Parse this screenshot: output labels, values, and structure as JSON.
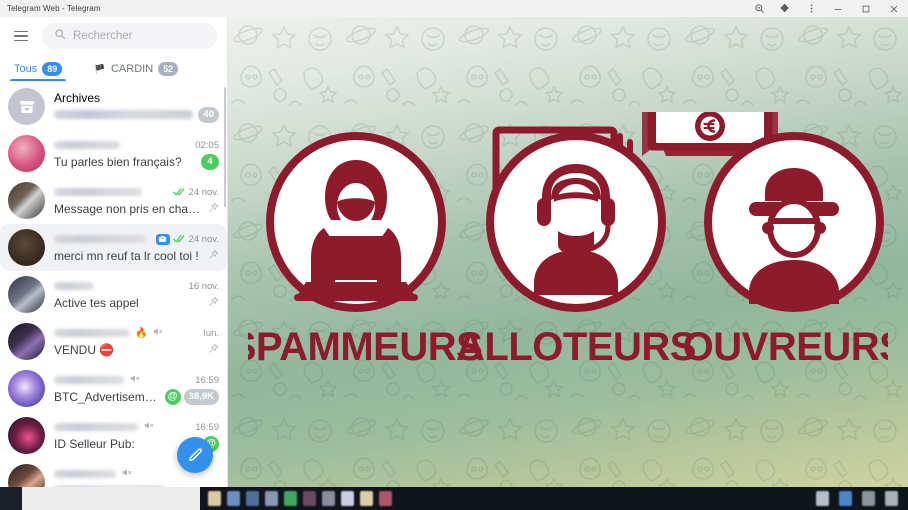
{
  "browser": {
    "tab_title": "Telegram Web - Telegram",
    "controls": [
      {
        "name": "zoom-icon",
        "label": "zoom"
      },
      {
        "name": "extensions-puzzle-icon",
        "label": "extensions"
      },
      {
        "name": "more-menu-icon",
        "label": "menu"
      },
      {
        "name": "minimize-icon",
        "label": "minimize"
      },
      {
        "name": "maximize-icon",
        "label": "maximize"
      },
      {
        "name": "close-icon",
        "label": "close"
      }
    ]
  },
  "sidebar": {
    "menu_icon": "hamburger-menu-icon",
    "search": {
      "placeholder": "Rechercher",
      "value": "",
      "icon": "search-icon"
    },
    "tabs": [
      {
        "label": "Tous",
        "count": "89",
        "active": true,
        "flag": ""
      },
      {
        "label": "CARDIN",
        "count": "52",
        "active": false,
        "flag": "🏴"
      }
    ],
    "compose_button": "pencil-compose-icon",
    "chats": [
      {
        "title": "Archives",
        "title_blurred": false,
        "preview": "",
        "preview_blurred": true,
        "time": "",
        "badge": "40",
        "badge_kind": "gray",
        "avatar_kind": "archive",
        "selected": false,
        "pinned": false,
        "read_receipt": false,
        "muted": false
      },
      {
        "title": "",
        "title_blurred": true,
        "preview": "Tu parles bien français?",
        "preview_blurred": false,
        "time": "02:05",
        "badge": "4",
        "badge_kind": "green",
        "avatar_kind": "panda",
        "selected": false,
        "pinned": false,
        "read_receipt": false,
        "muted": false
      },
      {
        "title": "",
        "title_blurred": true,
        "preview": "Message non pris en charge",
        "preview_blurred": false,
        "time": "24 nov.",
        "badge": "",
        "badge_kind": "",
        "avatar_kind": "photo-brown",
        "selected": false,
        "pinned": true,
        "read_receipt": true,
        "muted": false
      },
      {
        "title": "",
        "title_blurred": true,
        "preview": "merci mn reuf ta lr cool toi !",
        "preview_blurred": false,
        "time": "24 nov.",
        "badge": "",
        "badge_kind": "",
        "avatar_kind": "photo-dark",
        "selected": true,
        "pinned": true,
        "read_receipt": true,
        "muted": false,
        "bot_badge": true
      },
      {
        "title": "",
        "title_blurred": true,
        "preview": "Active tes appel",
        "preview_blurred": false,
        "time": "16 nov.",
        "badge": "",
        "badge_kind": "",
        "avatar_kind": "photo-statue",
        "selected": false,
        "pinned": true,
        "read_receipt": false,
        "muted": false
      },
      {
        "title": "",
        "title_blurred": true,
        "preview": "VENDU ⛔",
        "preview_blurred": false,
        "time": "lun.",
        "badge": "",
        "badge_kind": "",
        "avatar_kind": "photo-purple",
        "selected": false,
        "pinned": true,
        "read_receipt": false,
        "muted": true,
        "fire": "🔥"
      },
      {
        "title": "",
        "title_blurred": true,
        "preview": "BTC_Advertisement …",
        "preview_blurred": false,
        "time": "16:59",
        "badge": "38,9K",
        "badge_kind": "gray",
        "avatar_kind": "photo-galaxy",
        "selected": false,
        "pinned": false,
        "read_receipt": false,
        "muted": true,
        "mention": "@"
      },
      {
        "title": "",
        "title_blurred": true,
        "preview": "ID Selleur Pub:",
        "preview_blurred": false,
        "time": "16:59",
        "badge": "",
        "badge_kind": "",
        "avatar_kind": "photo-pink",
        "selected": false,
        "pinned": false,
        "read_receipt": false,
        "muted": true,
        "mention": "@"
      },
      {
        "title": "",
        "title_blurred": true,
        "preview": "",
        "preview_blurred": true,
        "time": "",
        "badge": "",
        "badge_kind": "",
        "avatar_kind": "photo-person",
        "selected": false,
        "pinned": false,
        "read_receipt": false,
        "muted": true
      }
    ]
  },
  "chat_pane": {
    "wallpaper": "space-doodle-pattern",
    "poster": {
      "accent_color": "#8e1b2c",
      "items": [
        {
          "label": "SPAMMEURS",
          "icon": "hooded-hacker-laptop-icon"
        },
        {
          "label": "ALLOTEURS",
          "icon": "headset-operator-icon"
        },
        {
          "label": "OUVREURS",
          "icon": "capped-person-icon"
        }
      ],
      "decoration": "euro-banknotes-icon"
    }
  },
  "taskbar": {
    "items": [
      {
        "name": "taskbar-icon-1",
        "color": "#d9c9a2"
      },
      {
        "name": "taskbar-icon-2",
        "color": "#6a8fc0"
      },
      {
        "name": "taskbar-icon-3",
        "color": "#4f6f9a"
      },
      {
        "name": "taskbar-icon-4",
        "color": "#8a97b5"
      },
      {
        "name": "taskbar-icon-5",
        "color": "#3fa85e"
      },
      {
        "name": "taskbar-icon-6",
        "color": "#6a4a63"
      },
      {
        "name": "taskbar-icon-7",
        "color": "#8d8d9e"
      },
      {
        "name": "taskbar-icon-8",
        "color": "#c9cfe0"
      },
      {
        "name": "taskbar-icon-9",
        "color": "#d8cfa8"
      },
      {
        "name": "taskbar-icon-10",
        "color": "#b0566a"
      }
    ],
    "tray": [
      {
        "name": "tray-icon-1",
        "color": "#b6bcc8"
      },
      {
        "name": "tray-icon-2",
        "color": "#4a86c8"
      },
      {
        "name": "tray-icon-3",
        "color": "#8e949f"
      },
      {
        "name": "tray-icon-4",
        "color": "#a9aeb8"
      }
    ]
  }
}
